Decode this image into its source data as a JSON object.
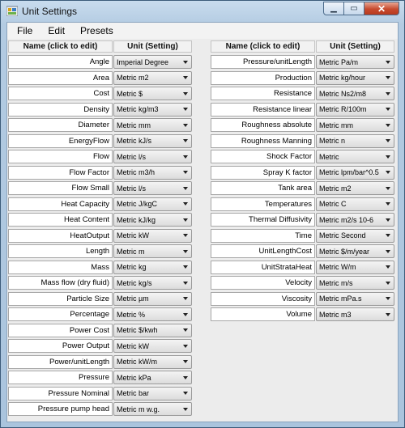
{
  "window": {
    "title": "Unit Settings"
  },
  "menu": [
    {
      "label": "File"
    },
    {
      "label": "Edit"
    },
    {
      "label": "Presets"
    }
  ],
  "headers": {
    "name": "Name (click to edit)",
    "unit": "Unit (Setting)"
  },
  "left": [
    {
      "name": "Angle",
      "unit": "Imperial Degree"
    },
    {
      "name": "Area",
      "unit": "Metric m2"
    },
    {
      "name": "Cost",
      "unit": "Metric $"
    },
    {
      "name": "Density",
      "unit": "Metric kg/m3"
    },
    {
      "name": "Diameter",
      "unit": "Metric mm"
    },
    {
      "name": "EnergyFlow",
      "unit": "Metric kJ/s"
    },
    {
      "name": "Flow",
      "unit": "Metric l/s"
    },
    {
      "name": "Flow Factor",
      "unit": "Metric m3/h"
    },
    {
      "name": "Flow Small",
      "unit": "Metric l/s"
    },
    {
      "name": "Heat Capacity",
      "unit": "Metric J/kgC"
    },
    {
      "name": "Heat Content",
      "unit": "Metric kJ/kg"
    },
    {
      "name": "HeatOutput",
      "unit": "Metric kW"
    },
    {
      "name": "Length",
      "unit": "Metric m"
    },
    {
      "name": "Mass",
      "unit": "Metric kg"
    },
    {
      "name": "Mass flow (dry fluid)",
      "unit": "Metric kg/s"
    },
    {
      "name": "Particle Size",
      "unit": "Metric µm"
    },
    {
      "name": "Percentage",
      "unit": "Metric %"
    },
    {
      "name": "Power Cost",
      "unit": "Metric $/kwh"
    },
    {
      "name": "Power Output",
      "unit": "Metric kW"
    },
    {
      "name": "Power/unitLength",
      "unit": "Metric kW/m"
    },
    {
      "name": "Pressure",
      "unit": "Metric kPa"
    },
    {
      "name": "Pressure Nominal",
      "unit": "Metric bar"
    },
    {
      "name": "Pressure pump head",
      "unit": "Metric m w.g."
    }
  ],
  "right": [
    {
      "name": "Pressure/unitLength",
      "unit": "Metric Pa/m"
    },
    {
      "name": "Production",
      "unit": "Metric kg/hour"
    },
    {
      "name": "Resistance",
      "unit": "Metric Ns2/m8"
    },
    {
      "name": "Resistance linear",
      "unit": "Metric R/100m"
    },
    {
      "name": "Roughness absolute",
      "unit": "Metric mm"
    },
    {
      "name": "Roughness Manning",
      "unit": "Metric n"
    },
    {
      "name": "Shock Factor",
      "unit": "Metric"
    },
    {
      "name": "Spray K factor",
      "unit": "Metric lpm/bar^0.5"
    },
    {
      "name": "Tank area",
      "unit": "Metric m2"
    },
    {
      "name": "Temperatures",
      "unit": "Metric C"
    },
    {
      "name": "Thermal Diffusivity",
      "unit": "Metric m2/s 10-6"
    },
    {
      "name": "Time",
      "unit": "Metric Second"
    },
    {
      "name": "UnitLengthCost",
      "unit": "Metric $/m/year"
    },
    {
      "name": "UnitStrataHeat",
      "unit": "Metric W/m"
    },
    {
      "name": "Velocity",
      "unit": "Metric m/s"
    },
    {
      "name": "Viscosity",
      "unit": "Metric mPa.s"
    },
    {
      "name": "Volume",
      "unit": "Metric m3"
    }
  ]
}
